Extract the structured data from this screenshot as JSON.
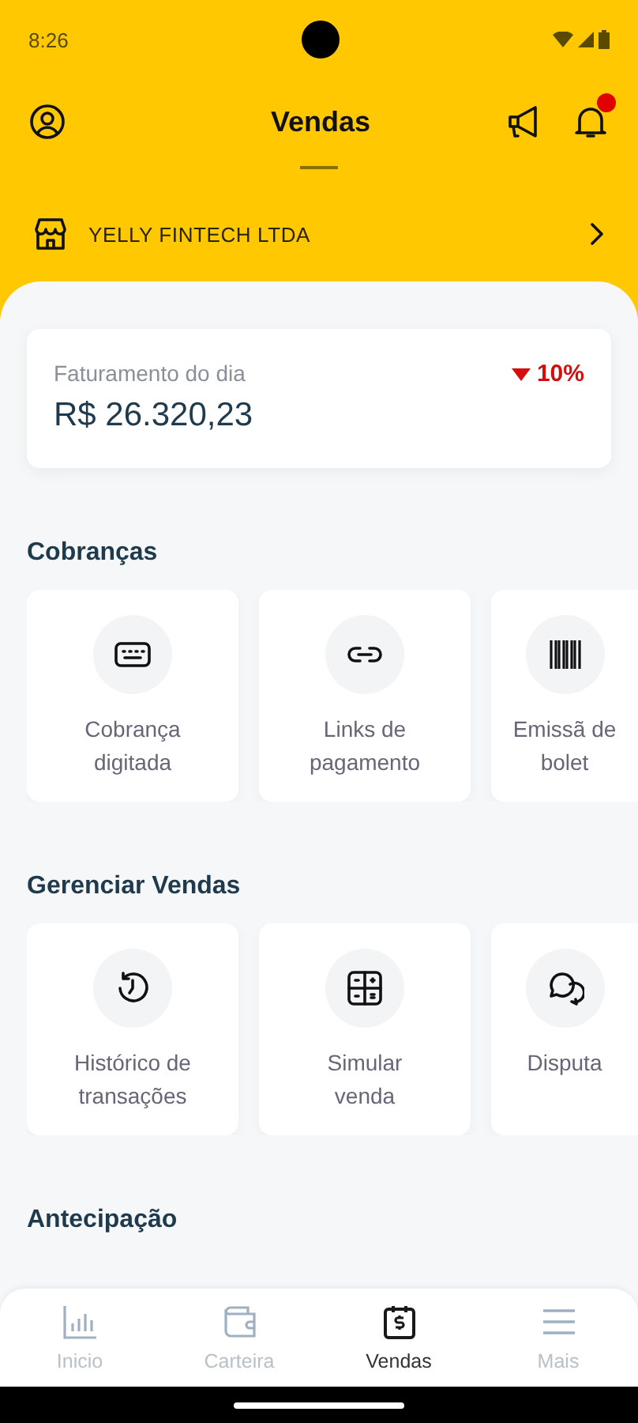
{
  "status_bar": {
    "time": "8:26"
  },
  "header": {
    "title": "Vendas",
    "notifications_unread": true
  },
  "company": {
    "name": "YELLY FINTECH LTDA"
  },
  "revenue": {
    "label": "Faturamento do dia",
    "value": "R$ 26.320,23",
    "change": "10%",
    "trend_down": true
  },
  "sections": [
    {
      "title": "Cobranças",
      "tiles": [
        {
          "label": "Cobrança digitada"
        },
        {
          "label": "Links de pagamento"
        },
        {
          "label": "Emissã de bolet"
        }
      ]
    },
    {
      "title": "Gerenciar Vendas",
      "tiles": [
        {
          "label": "Histórico de transações"
        },
        {
          "label": "Simular venda"
        },
        {
          "label": "Disputa"
        }
      ]
    },
    {
      "title": "Antecipação"
    }
  ],
  "bottom_nav": [
    {
      "label": "Inicio",
      "selected": false
    },
    {
      "label": "Carteira",
      "selected": false
    },
    {
      "label": "Vendas",
      "selected": true
    },
    {
      "label": "Mais",
      "selected": false
    }
  ]
}
